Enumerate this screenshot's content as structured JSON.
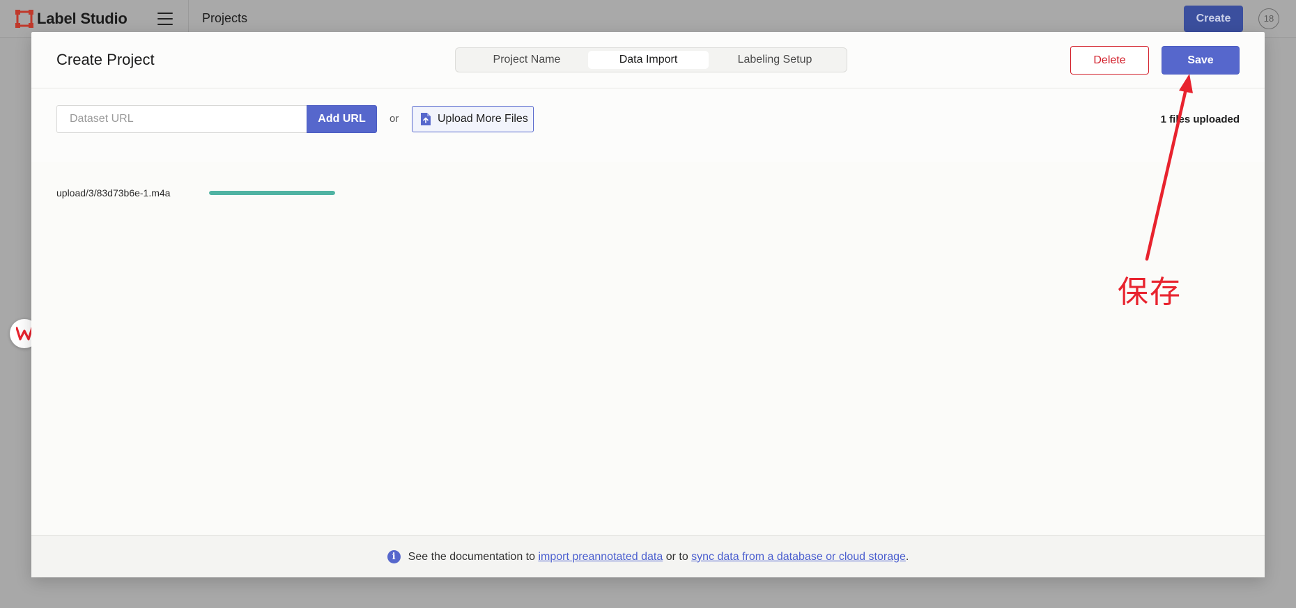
{
  "app": {
    "name": "Label Studio",
    "breadcrumb": "Projects",
    "create_label": "Create",
    "avatar_text": "18",
    "logo_icon": "label-studio-logo-icon",
    "menu_icon": "hamburger-menu-icon"
  },
  "modal": {
    "title": "Create Project",
    "steps": [
      {
        "label": "Project Name",
        "active": false
      },
      {
        "label": "Data Import",
        "active": true
      },
      {
        "label": "Labeling Setup",
        "active": false
      }
    ],
    "delete_label": "Delete",
    "save_label": "Save"
  },
  "import": {
    "url_placeholder": "Dataset URL",
    "url_value": "",
    "add_url_label": "Add URL",
    "or_text": "or",
    "upload_label": "Upload More Files",
    "upload_icon": "file-upload-icon",
    "files_count_text": "1 files uploaded"
  },
  "files": [
    {
      "name": "upload/3/83d73b6e-1.m4a",
      "progress": 1.0
    }
  ],
  "footer": {
    "prefix": "See the documentation to ",
    "link1": "import preannotated data",
    "middle": " or to ",
    "link2": "sync data from a database or cloud storage",
    "suffix": ".",
    "info_icon": "info-icon"
  },
  "annotation": {
    "text": "保存",
    "color": "#e8232e"
  },
  "colors": {
    "primary": "#5667cc",
    "danger": "#d21f2a",
    "progress": "#4fb3a3"
  }
}
